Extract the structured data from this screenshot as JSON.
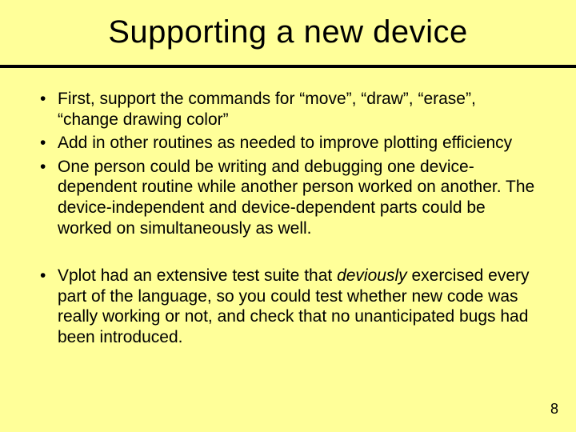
{
  "slide": {
    "title": "Supporting a new device",
    "bullets_a": [
      "First, support the commands for “move”, “draw”, “erase”, “change drawing color”",
      "Add in other routines as needed to improve plotting efficiency",
      "One person could be writing and debugging one device-dependent routine while another person worked on another. The device-independent and device-dependent parts could be worked on simultaneously as well."
    ],
    "bullets_b_pre": "Vplot had an extensive test suite that ",
    "bullets_b_em": "deviously",
    "bullets_b_post": " exercised every part of the language, so you could test whether new code was really working or not, and check that no unanticipated bugs had been introduced.",
    "page_number": "8"
  }
}
